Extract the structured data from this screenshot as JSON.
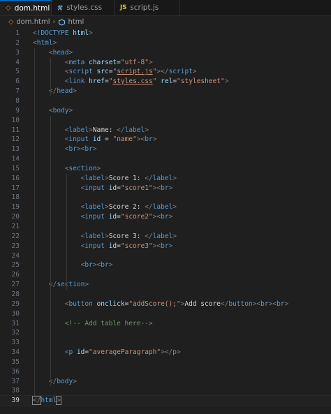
{
  "tabs": [
    {
      "name": "dom.html",
      "icon": "html-file-icon",
      "glyph": "◇",
      "active": true,
      "close": "×"
    },
    {
      "name": "styles.css",
      "icon": "css-file-icon",
      "glyph": "#",
      "active": false
    },
    {
      "name": "script.js",
      "icon": "js-file-icon",
      "glyph": "JS",
      "active": false
    }
  ],
  "breadcrumb": {
    "file": "dom.html",
    "separator": "›",
    "element": "html"
  },
  "colors": {
    "background": "#1f1f1f",
    "tag": "#569cd6",
    "attribute": "#9cdcfe",
    "string": "#ce9178",
    "text": "#d4d4d4",
    "comment": "#6a9955",
    "bracket": "#808080",
    "line_number": "#6e7681",
    "active_tab_border": "#0078d4"
  },
  "editor": {
    "current_line": 39,
    "lines": [
      {
        "n": "1",
        "indent": 0,
        "tokens": [
          [
            "br",
            "<"
          ],
          [
            "tag",
            "!DOCTYPE"
          ],
          [
            "txt",
            " "
          ],
          [
            "attr",
            "html"
          ],
          [
            "br",
            ">"
          ]
        ]
      },
      {
        "n": "2",
        "indent": 0,
        "tokens": [
          [
            "br",
            "<"
          ],
          [
            "tag",
            "html"
          ],
          [
            "br",
            ">"
          ]
        ]
      },
      {
        "n": "3",
        "indent": 1,
        "tokens": [
          [
            "br",
            "<"
          ],
          [
            "tag",
            "head"
          ],
          [
            "br",
            ">"
          ]
        ]
      },
      {
        "n": "4",
        "indent": 2,
        "tokens": [
          [
            "br",
            "<"
          ],
          [
            "tag",
            "meta"
          ],
          [
            "txt",
            " "
          ],
          [
            "attr",
            "charset"
          ],
          [
            "eq",
            "="
          ],
          [
            "str",
            "\"utf-8\""
          ],
          [
            "br",
            ">"
          ]
        ]
      },
      {
        "n": "5",
        "indent": 2,
        "tokens": [
          [
            "br",
            "<"
          ],
          [
            "tag",
            "script"
          ],
          [
            "txt",
            " "
          ],
          [
            "attr",
            "src"
          ],
          [
            "eq",
            "="
          ],
          [
            "str",
            "\""
          ],
          [
            "strlink",
            "script.js"
          ],
          [
            "str",
            "\""
          ],
          [
            "br",
            "></"
          ],
          [
            "tag",
            "script"
          ],
          [
            "br",
            ">"
          ]
        ]
      },
      {
        "n": "6",
        "indent": 2,
        "tokens": [
          [
            "br",
            "<"
          ],
          [
            "tag",
            "link"
          ],
          [
            "txt",
            " "
          ],
          [
            "attr",
            "href"
          ],
          [
            "eq",
            "="
          ],
          [
            "str",
            "\""
          ],
          [
            "strlink",
            "styles.css"
          ],
          [
            "str",
            "\""
          ],
          [
            "txt",
            " "
          ],
          [
            "attr",
            "rel"
          ],
          [
            "eq",
            "="
          ],
          [
            "str",
            "\"stylesheet\""
          ],
          [
            "br",
            ">"
          ]
        ]
      },
      {
        "n": "7",
        "indent": 1,
        "tokens": [
          [
            "br",
            "</"
          ],
          [
            "tag",
            "head"
          ],
          [
            "br",
            ">"
          ]
        ]
      },
      {
        "n": "8",
        "indent": 0,
        "tokens": []
      },
      {
        "n": "9",
        "indent": 1,
        "tokens": [
          [
            "br",
            "<"
          ],
          [
            "tag",
            "body"
          ],
          [
            "br",
            ">"
          ]
        ]
      },
      {
        "n": "10",
        "indent": 0,
        "tokens": []
      },
      {
        "n": "11",
        "indent": 2,
        "tokens": [
          [
            "br",
            "<"
          ],
          [
            "tag",
            "label"
          ],
          [
            "br",
            ">"
          ],
          [
            "txt",
            "Name: "
          ],
          [
            "br",
            "</"
          ],
          [
            "tag",
            "label"
          ],
          [
            "br",
            ">"
          ]
        ]
      },
      {
        "n": "12",
        "indent": 2,
        "tokens": [
          [
            "br",
            "<"
          ],
          [
            "tag",
            "input"
          ],
          [
            "txt",
            " "
          ],
          [
            "attr",
            "id"
          ],
          [
            "txt",
            " "
          ],
          [
            "eq",
            "="
          ],
          [
            "txt",
            " "
          ],
          [
            "str",
            "\"name\""
          ],
          [
            "br",
            ">"
          ],
          [
            "br",
            "<"
          ],
          [
            "tag",
            "br"
          ],
          [
            "br",
            ">"
          ]
        ]
      },
      {
        "n": "13",
        "indent": 2,
        "tokens": [
          [
            "br",
            "<"
          ],
          [
            "tag",
            "br"
          ],
          [
            "br",
            ">"
          ],
          [
            "br",
            "<"
          ],
          [
            "tag",
            "br"
          ],
          [
            "br",
            ">"
          ]
        ]
      },
      {
        "n": "14",
        "indent": 0,
        "tokens": []
      },
      {
        "n": "15",
        "indent": 2,
        "tokens": [
          [
            "br",
            "<"
          ],
          [
            "tag",
            "section"
          ],
          [
            "br",
            ">"
          ]
        ]
      },
      {
        "n": "16",
        "indent": 3,
        "tokens": [
          [
            "br",
            "<"
          ],
          [
            "tag",
            "label"
          ],
          [
            "br",
            ">"
          ],
          [
            "txt",
            "Score 1: "
          ],
          [
            "br",
            "</"
          ],
          [
            "tag",
            "label"
          ],
          [
            "br",
            ">"
          ]
        ]
      },
      {
        "n": "17",
        "indent": 3,
        "tokens": [
          [
            "br",
            "<"
          ],
          [
            "tag",
            "input"
          ],
          [
            "txt",
            " "
          ],
          [
            "attr",
            "id"
          ],
          [
            "eq",
            "="
          ],
          [
            "str",
            "\"score1\""
          ],
          [
            "br",
            ">"
          ],
          [
            "br",
            "<"
          ],
          [
            "tag",
            "br"
          ],
          [
            "br",
            ">"
          ]
        ]
      },
      {
        "n": "18",
        "indent": 0,
        "tokens": []
      },
      {
        "n": "19",
        "indent": 3,
        "tokens": [
          [
            "br",
            "<"
          ],
          [
            "tag",
            "label"
          ],
          [
            "br",
            ">"
          ],
          [
            "txt",
            "Score 2: "
          ],
          [
            "br",
            "</"
          ],
          [
            "tag",
            "label"
          ],
          [
            "br",
            ">"
          ]
        ]
      },
      {
        "n": "20",
        "indent": 3,
        "tokens": [
          [
            "br",
            "<"
          ],
          [
            "tag",
            "input"
          ],
          [
            "txt",
            " "
          ],
          [
            "attr",
            "id"
          ],
          [
            "eq",
            "="
          ],
          [
            "str",
            "\"score2\""
          ],
          [
            "br",
            ">"
          ],
          [
            "br",
            "<"
          ],
          [
            "tag",
            "br"
          ],
          [
            "br",
            ">"
          ]
        ]
      },
      {
        "n": "21",
        "indent": 0,
        "tokens": []
      },
      {
        "n": "22",
        "indent": 3,
        "tokens": [
          [
            "br",
            "<"
          ],
          [
            "tag",
            "label"
          ],
          [
            "br",
            ">"
          ],
          [
            "txt",
            "Score 3: "
          ],
          [
            "br",
            "</"
          ],
          [
            "tag",
            "label"
          ],
          [
            "br",
            ">"
          ]
        ]
      },
      {
        "n": "23",
        "indent": 3,
        "tokens": [
          [
            "br",
            "<"
          ],
          [
            "tag",
            "input"
          ],
          [
            "txt",
            " "
          ],
          [
            "attr",
            "id"
          ],
          [
            "eq",
            "="
          ],
          [
            "str",
            "\"score3\""
          ],
          [
            "br",
            ">"
          ],
          [
            "br",
            "<"
          ],
          [
            "tag",
            "br"
          ],
          [
            "br",
            ">"
          ]
        ]
      },
      {
        "n": "24",
        "indent": 0,
        "tokens": []
      },
      {
        "n": "25",
        "indent": 3,
        "tokens": [
          [
            "br",
            "<"
          ],
          [
            "tag",
            "br"
          ],
          [
            "br",
            ">"
          ],
          [
            "br",
            "<"
          ],
          [
            "tag",
            "br"
          ],
          [
            "br",
            ">"
          ]
        ]
      },
      {
        "n": "26",
        "indent": 0,
        "tokens": []
      },
      {
        "n": "27",
        "indent": 1,
        "tokens": [
          [
            "br",
            "</"
          ],
          [
            "tag",
            "section"
          ],
          [
            "br",
            ">"
          ]
        ]
      },
      {
        "n": "28",
        "indent": 0,
        "tokens": []
      },
      {
        "n": "29",
        "indent": 2,
        "tokens": [
          [
            "br",
            "<"
          ],
          [
            "tag",
            "button"
          ],
          [
            "txt",
            " "
          ],
          [
            "attr",
            "onclick"
          ],
          [
            "eq",
            "="
          ],
          [
            "str",
            "\"addScore();\""
          ],
          [
            "br",
            ">"
          ],
          [
            "txt",
            "Add score"
          ],
          [
            "br",
            "</"
          ],
          [
            "tag",
            "button"
          ],
          [
            "br",
            ">"
          ],
          [
            "br",
            "<"
          ],
          [
            "tag",
            "br"
          ],
          [
            "br",
            ">"
          ],
          [
            "br",
            "<"
          ],
          [
            "tag",
            "br"
          ],
          [
            "br",
            ">"
          ]
        ]
      },
      {
        "n": "30",
        "indent": 0,
        "tokens": []
      },
      {
        "n": "31",
        "indent": 2,
        "tokens": [
          [
            "com",
            "<!-- Add table here-->"
          ]
        ]
      },
      {
        "n": "32",
        "indent": 0,
        "tokens": []
      },
      {
        "n": "33",
        "indent": 0,
        "tokens": []
      },
      {
        "n": "34",
        "indent": 2,
        "tokens": [
          [
            "br",
            "<"
          ],
          [
            "tag",
            "p"
          ],
          [
            "txt",
            " "
          ],
          [
            "attr",
            "id"
          ],
          [
            "eq",
            "="
          ],
          [
            "str",
            "\"averageParagraph\""
          ],
          [
            "br",
            ">"
          ],
          [
            "br",
            "</"
          ],
          [
            "tag",
            "p"
          ],
          [
            "br",
            ">"
          ]
        ]
      },
      {
        "n": "35",
        "indent": 0,
        "tokens": []
      },
      {
        "n": "36",
        "indent": 0,
        "tokens": []
      },
      {
        "n": "37",
        "indent": 1,
        "tokens": [
          [
            "br",
            "</"
          ],
          [
            "tag",
            "body"
          ],
          [
            "br",
            ">"
          ]
        ]
      },
      {
        "n": "38",
        "indent": 0,
        "tokens": []
      },
      {
        "n": "39",
        "indent": 0,
        "tokens": [
          [
            "brmatch",
            "</"
          ],
          [
            "tag",
            "html"
          ],
          [
            "brmatch",
            ">"
          ]
        ]
      }
    ]
  }
}
